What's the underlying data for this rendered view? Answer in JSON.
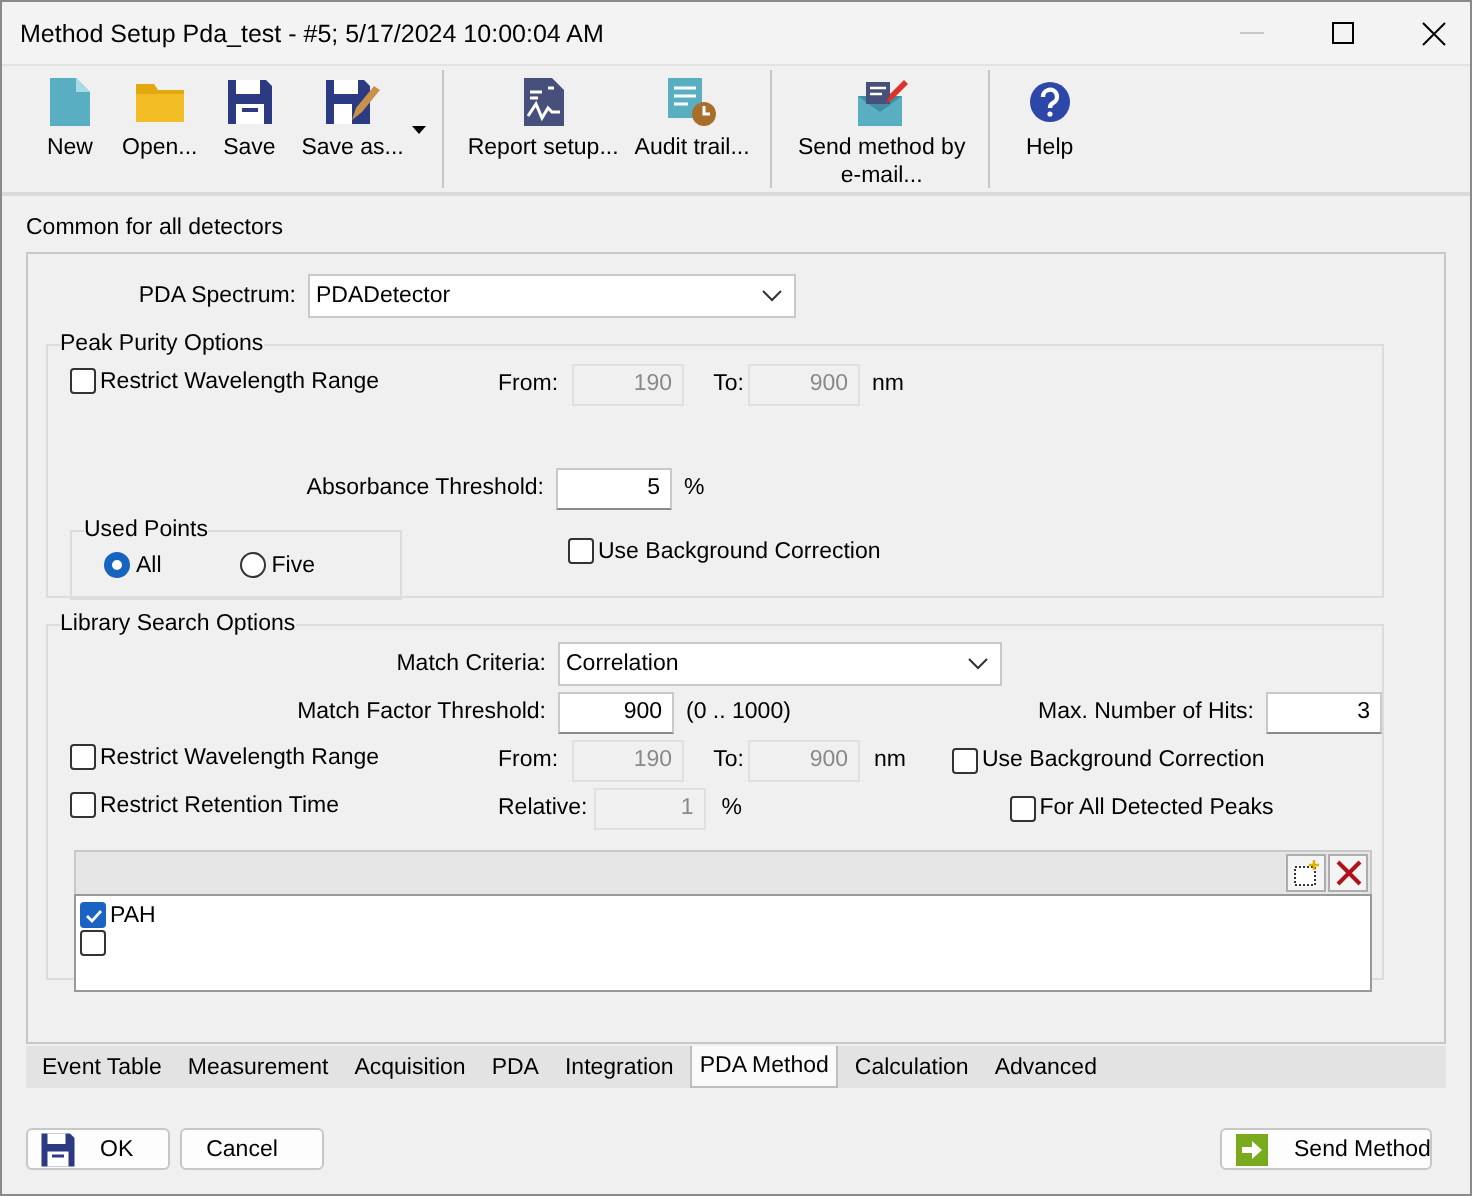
{
  "window": {
    "title": "Method Setup Pda_test - #5;   5/17/2024   10:00:04 AM"
  },
  "toolbar": [
    {
      "label": "New",
      "kind": "new",
      "separator_before": false
    },
    {
      "label": "Open...",
      "kind": "open",
      "separator_before": false
    },
    {
      "label": "Save",
      "kind": "save",
      "separator_before": false
    },
    {
      "label": "Save as...",
      "kind": "save-as",
      "separator_before": false,
      "dropdown": true
    },
    {
      "label": "Report setup...",
      "kind": "report",
      "separator_before": true
    },
    {
      "label": "Audit trail...",
      "kind": "audit",
      "separator_before": false
    },
    {
      "label": "Send method by e-mail...",
      "kind": "email",
      "separator_before": true
    },
    {
      "label": "Help",
      "kind": "help",
      "separator_before": true
    }
  ],
  "section_label": "Common for all detectors",
  "pda_spectrum": {
    "label": "PDA Spectrum:",
    "value": "PDADetector"
  },
  "peak_purity": {
    "title": "Peak Purity Options",
    "restrict_wavelength": {
      "label": "Restrict Wavelength Range",
      "checked": false
    },
    "from": {
      "label": "From:",
      "value": "190",
      "disabled": true
    },
    "to": {
      "label": "To:",
      "value": "900",
      "disabled": true
    },
    "unit": "nm",
    "absorbance": {
      "label": "Absorbance Threshold:",
      "value": "5",
      "disabled": false,
      "unit": "%"
    },
    "used_points": {
      "title": "Used Points",
      "options": [
        {
          "label": "All",
          "selected": true
        },
        {
          "label": "Five",
          "selected": false
        }
      ]
    },
    "background_correction": {
      "label": "Use Background Correction",
      "checked": false
    }
  },
  "library_search": {
    "title": "Library Search Options",
    "match_criteria": {
      "label": "Match Criteria:",
      "value": "Correlation"
    },
    "match_factor": {
      "label": "Match Factor Threshold:",
      "value": "900",
      "disabled": false,
      "range": "(0 .. 1000)"
    },
    "max_hits": {
      "label": "Max. Number of Hits:",
      "value": "3",
      "disabled": false
    },
    "restrict_wavelength": {
      "label": "Restrict Wavelength Range",
      "checked": false
    },
    "from": {
      "label": "From:",
      "value": "190",
      "disabled": true
    },
    "to": {
      "label": "To:",
      "value": "900",
      "disabled": true
    },
    "unit": "nm",
    "background_correction": {
      "label": "Use Background Correction",
      "checked": false
    },
    "restrict_retention": {
      "label": "Restrict Retention Time",
      "checked": false
    },
    "relative": {
      "label": "Relative:",
      "value": "1",
      "disabled": true,
      "unit": "%"
    },
    "all_peaks": {
      "label": "For All Detected Peaks",
      "checked": false
    },
    "libraries": [
      {
        "label": "PAH",
        "checked": true
      },
      {
        "checked": false
      }
    ]
  },
  "tabs": [
    {
      "label": "Event Table",
      "selected": false
    },
    {
      "label": "Measurement",
      "selected": false
    },
    {
      "label": "Acquisition",
      "selected": false
    },
    {
      "label": "PDA",
      "selected": false
    },
    {
      "label": "Integration",
      "selected": false
    },
    {
      "label": "PDA Method",
      "selected": true
    },
    {
      "label": "Calculation",
      "selected": false
    },
    {
      "label": "Advanced",
      "selected": false
    }
  ],
  "buttons": [
    {
      "label": "OK",
      "kind": "save"
    },
    {
      "label": "Cancel"
    },
    {
      "label": "Send Method",
      "kind": "send"
    }
  ]
}
